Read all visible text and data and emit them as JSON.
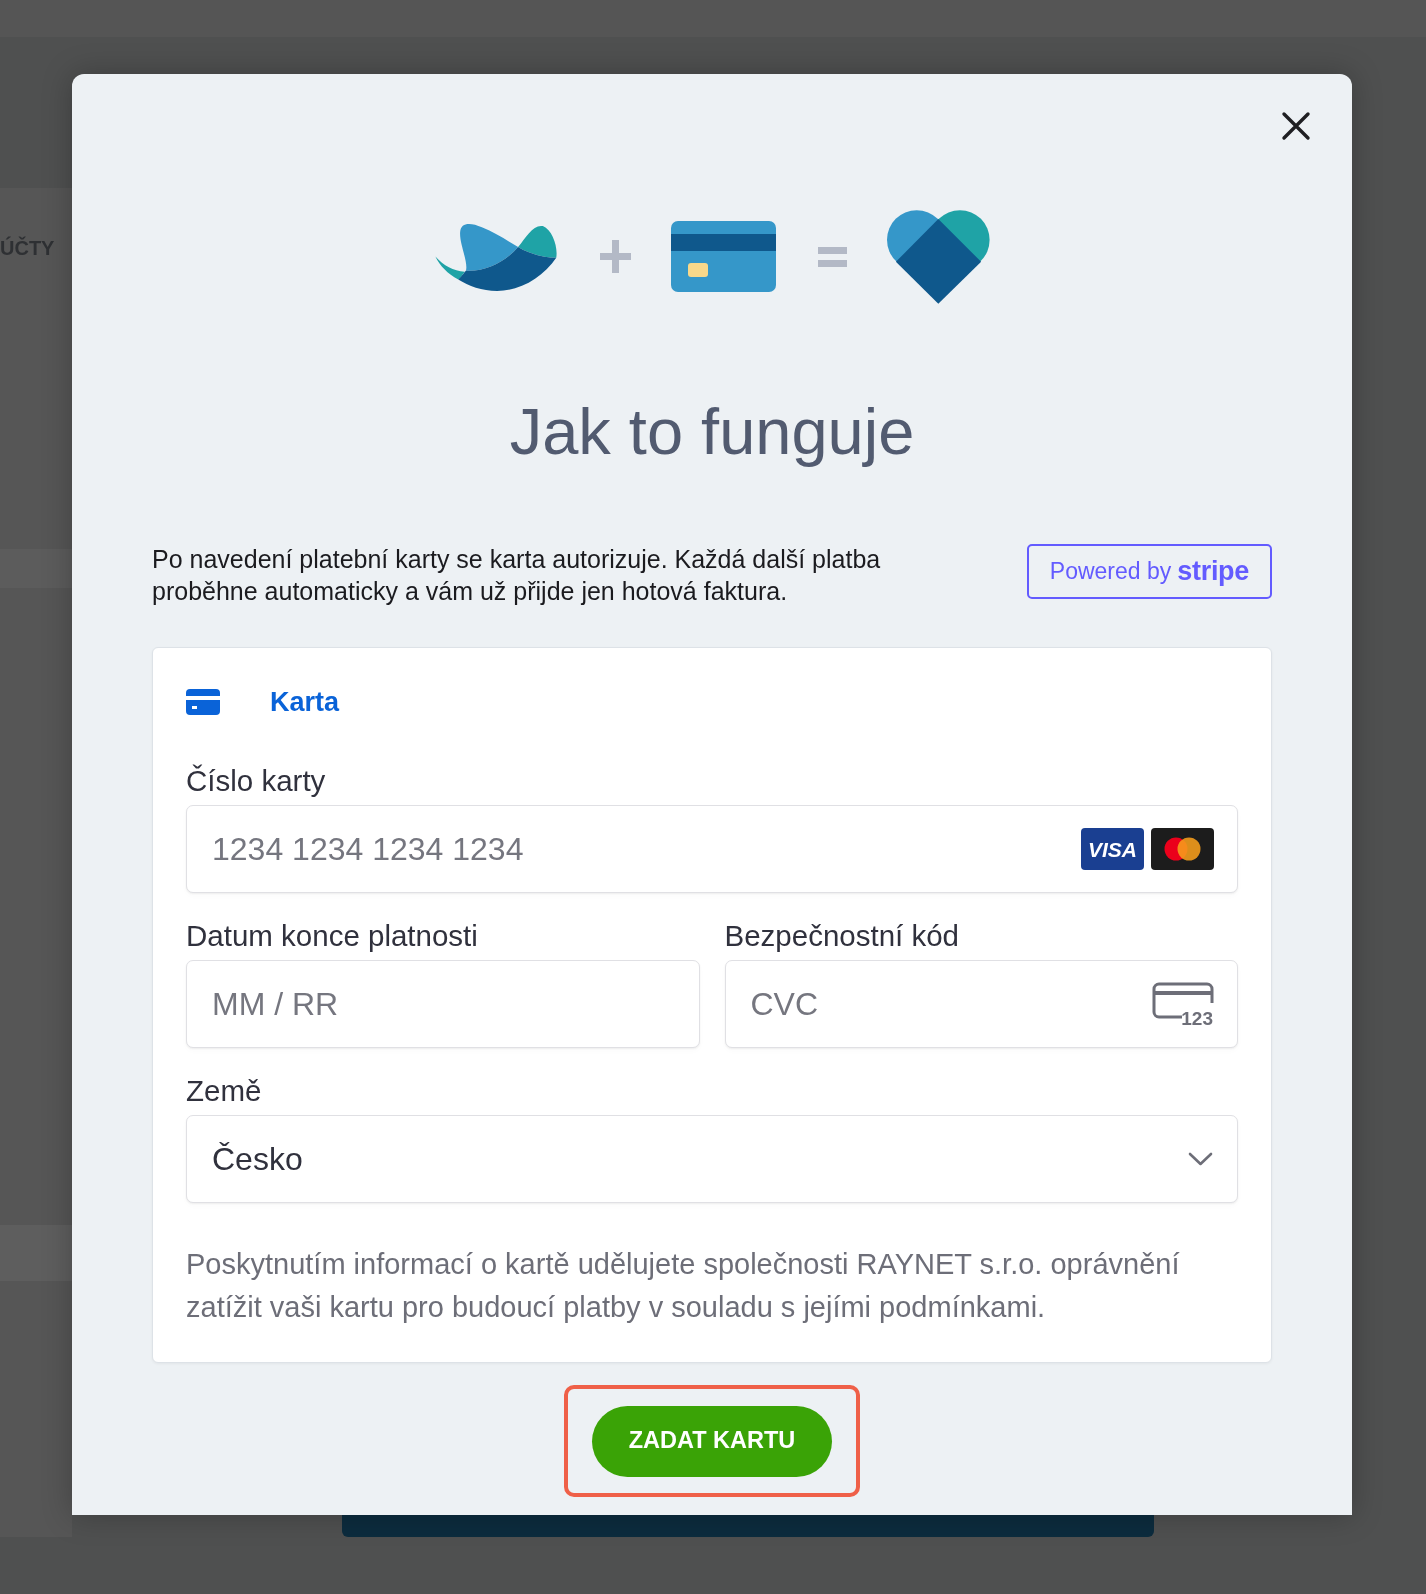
{
  "background": {
    "section_label": "ÚČTY"
  },
  "modal": {
    "title": "Jak to funguje",
    "intro": "Po navedení platební karty se karta autorizuje. Každá další platba proběhne automaticky a vám už přijde jen hotová faktura.",
    "badge": "Powered by **stripe**",
    "payment_form": {
      "methods": [
        {
          "label": "Karta",
          "selected": true
        }
      ],
      "fields": [
        {
          "kind": "card_number",
          "label": "Číslo karty",
          "placeholder": "1234 1234 1234 1234",
          "brand_logos": [
            {
              "kind": "visa",
              "label": "VISA"
            },
            {
              "kind": "mastercard"
            }
          ]
        },
        {
          "kind": "expiry",
          "label": "Datum konce platnosti",
          "placeholder": "MM / RR"
        },
        {
          "kind": "cvc",
          "label": "Bezpečnostní kód",
          "placeholder": "CVC",
          "icon_text": "123"
        },
        {
          "kind": "select",
          "label": "Země",
          "value": "Česko"
        }
      ],
      "consent": "Poskytnutím informací o kartě udělujete společnosti RAYNET s.r.o. oprávnění zatížit vaši kartu pro budoucí platby v souladu s jejími podmínkami."
    },
    "submit": {
      "label": "ZADAT KARTU",
      "highlighted": true
    }
  }
}
